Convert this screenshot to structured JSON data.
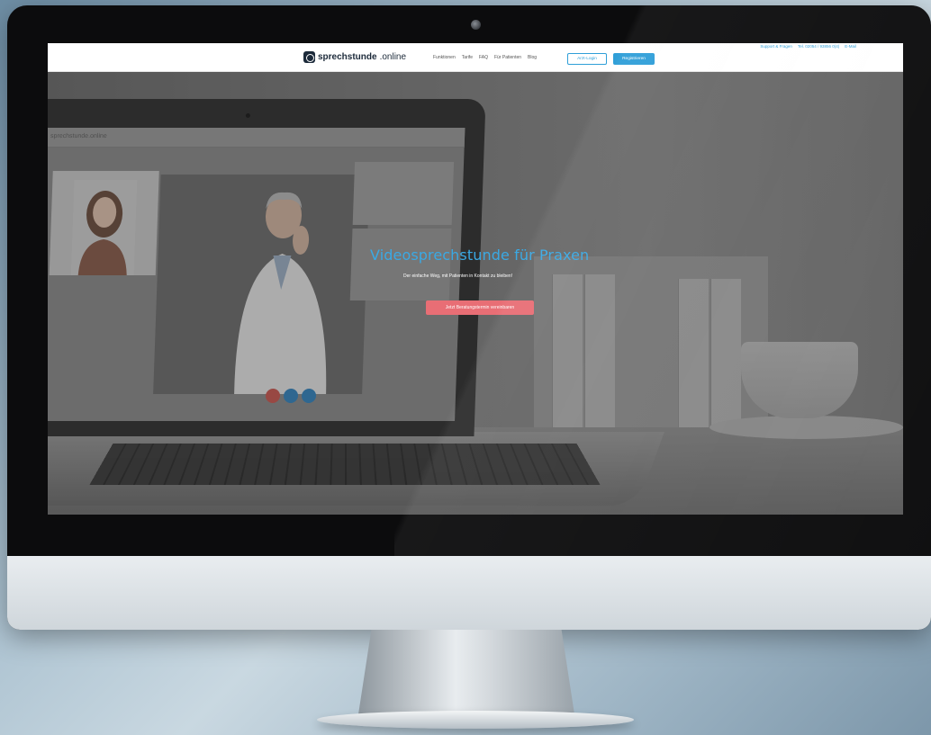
{
  "navbar": {
    "support_label": "Support & Fragen",
    "phone": "Tel. 02054 / 93856 0(4)",
    "mail": "E-Mail",
    "logo_bold": "sprechstunde",
    "logo_light": ".online",
    "links": [
      "Funktionen",
      "Tarife",
      "FAQ",
      "Für Patienten",
      "Blog"
    ],
    "login_label": "Arzt-Login",
    "register_label": "Registrieren"
  },
  "laptop_app": {
    "logo": "sprechstunde.online"
  },
  "hero": {
    "title": "Videosprechstunde für Praxen",
    "subtitle": "Der einfache Weg, mit Patienten in Kontakt zu bleiben!",
    "cta_label": "Jetzt Beratungstermin vereinbaren"
  },
  "colors": {
    "accent_blue": "#3aa9e4",
    "cta_red": "#e86e75",
    "logo_dark": "#1c2a3a"
  }
}
